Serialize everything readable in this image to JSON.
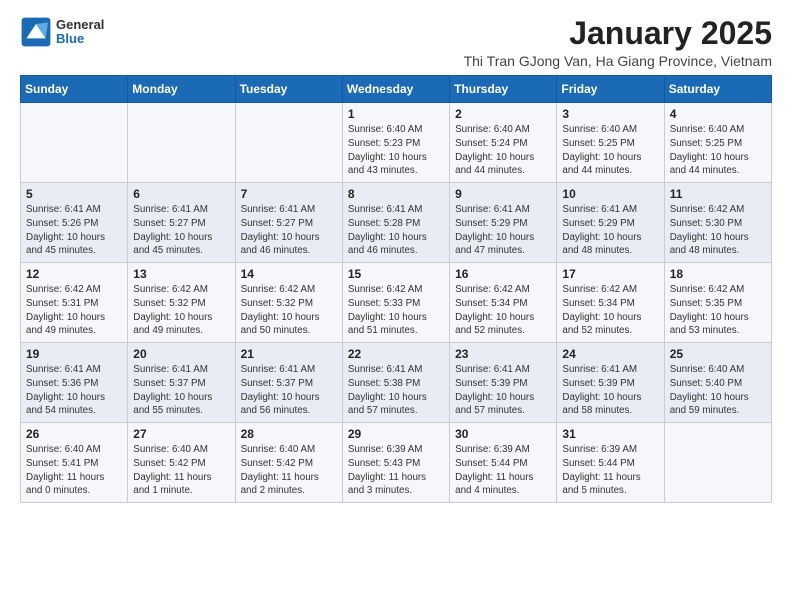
{
  "header": {
    "month_title": "January 2025",
    "location": "Thi Tran GJong Van, Ha Giang Province, Vietnam",
    "logo_general": "General",
    "logo_blue": "Blue"
  },
  "weekdays": [
    "Sunday",
    "Monday",
    "Tuesday",
    "Wednesday",
    "Thursday",
    "Friday",
    "Saturday"
  ],
  "weeks": [
    [
      {
        "day": "",
        "info": ""
      },
      {
        "day": "",
        "info": ""
      },
      {
        "day": "",
        "info": ""
      },
      {
        "day": "1",
        "info": "Sunrise: 6:40 AM\nSunset: 5:23 PM\nDaylight: 10 hours and 43 minutes."
      },
      {
        "day": "2",
        "info": "Sunrise: 6:40 AM\nSunset: 5:24 PM\nDaylight: 10 hours and 44 minutes."
      },
      {
        "day": "3",
        "info": "Sunrise: 6:40 AM\nSunset: 5:25 PM\nDaylight: 10 hours and 44 minutes."
      },
      {
        "day": "4",
        "info": "Sunrise: 6:40 AM\nSunset: 5:25 PM\nDaylight: 10 hours and 44 minutes."
      }
    ],
    [
      {
        "day": "5",
        "info": "Sunrise: 6:41 AM\nSunset: 5:26 PM\nDaylight: 10 hours and 45 minutes."
      },
      {
        "day": "6",
        "info": "Sunrise: 6:41 AM\nSunset: 5:27 PM\nDaylight: 10 hours and 45 minutes."
      },
      {
        "day": "7",
        "info": "Sunrise: 6:41 AM\nSunset: 5:27 PM\nDaylight: 10 hours and 46 minutes."
      },
      {
        "day": "8",
        "info": "Sunrise: 6:41 AM\nSunset: 5:28 PM\nDaylight: 10 hours and 46 minutes."
      },
      {
        "day": "9",
        "info": "Sunrise: 6:41 AM\nSunset: 5:29 PM\nDaylight: 10 hours and 47 minutes."
      },
      {
        "day": "10",
        "info": "Sunrise: 6:41 AM\nSunset: 5:29 PM\nDaylight: 10 hours and 48 minutes."
      },
      {
        "day": "11",
        "info": "Sunrise: 6:42 AM\nSunset: 5:30 PM\nDaylight: 10 hours and 48 minutes."
      }
    ],
    [
      {
        "day": "12",
        "info": "Sunrise: 6:42 AM\nSunset: 5:31 PM\nDaylight: 10 hours and 49 minutes."
      },
      {
        "day": "13",
        "info": "Sunrise: 6:42 AM\nSunset: 5:32 PM\nDaylight: 10 hours and 49 minutes."
      },
      {
        "day": "14",
        "info": "Sunrise: 6:42 AM\nSunset: 5:32 PM\nDaylight: 10 hours and 50 minutes."
      },
      {
        "day": "15",
        "info": "Sunrise: 6:42 AM\nSunset: 5:33 PM\nDaylight: 10 hours and 51 minutes."
      },
      {
        "day": "16",
        "info": "Sunrise: 6:42 AM\nSunset: 5:34 PM\nDaylight: 10 hours and 52 minutes."
      },
      {
        "day": "17",
        "info": "Sunrise: 6:42 AM\nSunset: 5:34 PM\nDaylight: 10 hours and 52 minutes."
      },
      {
        "day": "18",
        "info": "Sunrise: 6:42 AM\nSunset: 5:35 PM\nDaylight: 10 hours and 53 minutes."
      }
    ],
    [
      {
        "day": "19",
        "info": "Sunrise: 6:41 AM\nSunset: 5:36 PM\nDaylight: 10 hours and 54 minutes."
      },
      {
        "day": "20",
        "info": "Sunrise: 6:41 AM\nSunset: 5:37 PM\nDaylight: 10 hours and 55 minutes."
      },
      {
        "day": "21",
        "info": "Sunrise: 6:41 AM\nSunset: 5:37 PM\nDaylight: 10 hours and 56 minutes."
      },
      {
        "day": "22",
        "info": "Sunrise: 6:41 AM\nSunset: 5:38 PM\nDaylight: 10 hours and 57 minutes."
      },
      {
        "day": "23",
        "info": "Sunrise: 6:41 AM\nSunset: 5:39 PM\nDaylight: 10 hours and 57 minutes."
      },
      {
        "day": "24",
        "info": "Sunrise: 6:41 AM\nSunset: 5:39 PM\nDaylight: 10 hours and 58 minutes."
      },
      {
        "day": "25",
        "info": "Sunrise: 6:40 AM\nSunset: 5:40 PM\nDaylight: 10 hours and 59 minutes."
      }
    ],
    [
      {
        "day": "26",
        "info": "Sunrise: 6:40 AM\nSunset: 5:41 PM\nDaylight: 11 hours and 0 minutes."
      },
      {
        "day": "27",
        "info": "Sunrise: 6:40 AM\nSunset: 5:42 PM\nDaylight: 11 hours and 1 minute."
      },
      {
        "day": "28",
        "info": "Sunrise: 6:40 AM\nSunset: 5:42 PM\nDaylight: 11 hours and 2 minutes."
      },
      {
        "day": "29",
        "info": "Sunrise: 6:39 AM\nSunset: 5:43 PM\nDaylight: 11 hours and 3 minutes."
      },
      {
        "day": "30",
        "info": "Sunrise: 6:39 AM\nSunset: 5:44 PM\nDaylight: 11 hours and 4 minutes."
      },
      {
        "day": "31",
        "info": "Sunrise: 6:39 AM\nSunset: 5:44 PM\nDaylight: 11 hours and 5 minutes."
      },
      {
        "day": "",
        "info": ""
      }
    ]
  ]
}
